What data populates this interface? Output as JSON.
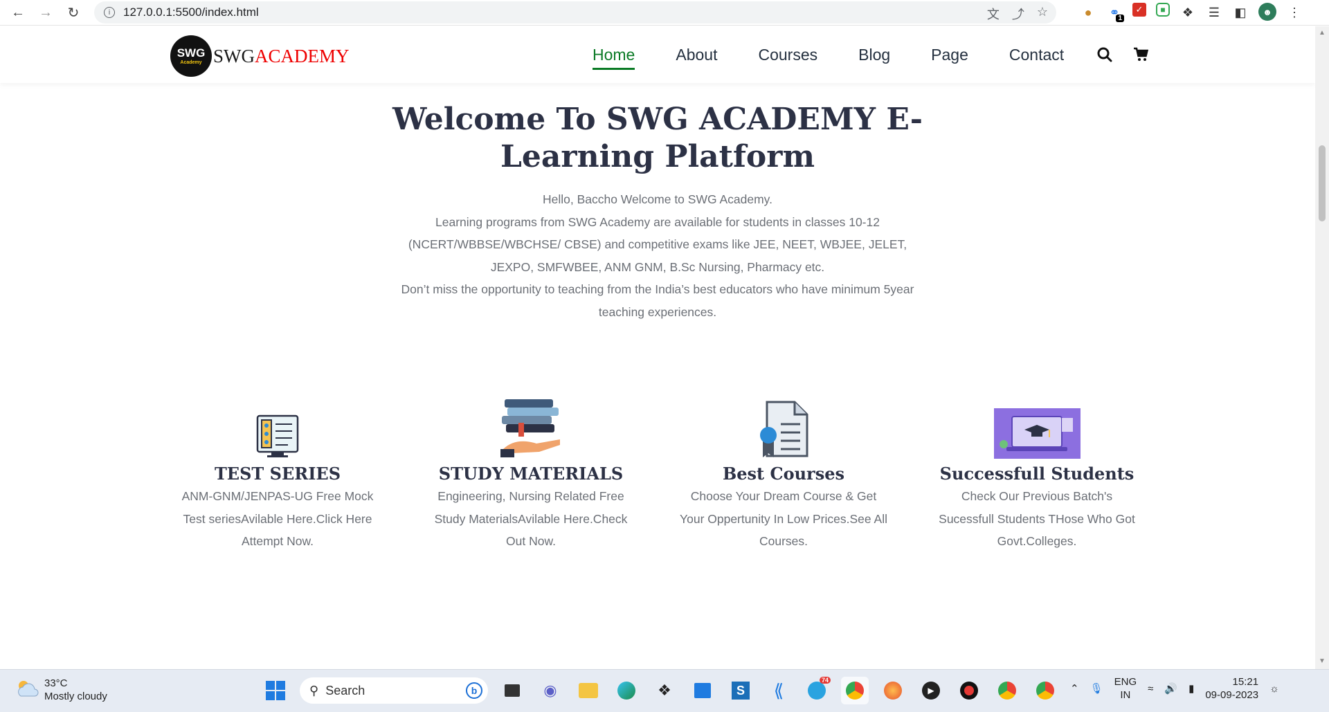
{
  "browser": {
    "url": "127.0.0.1:5500/index.html",
    "extension_badge": "1"
  },
  "site": {
    "logo_mark": "SWG",
    "logo_sub": "Academy",
    "brand_a": "SWG",
    "brand_b": "ACADEMY",
    "nav": [
      "Home",
      "About",
      "Courses",
      "Blog",
      "Page",
      "Contact"
    ],
    "active_nav": "Home"
  },
  "hero": {
    "title": "Welcome To SWG ACADEMY E-Learning Platform",
    "line1": "Hello, Baccho Welcome to SWG Academy.",
    "line2": "Learning programs from SWG Academy are available for students in classes 10-12 (NCERT/WBBSE/WBCHSE/ CBSE) and competitive exams like JEE, NEET, WBJEE, JELET, JEXPO, SMFWBEE, ANM GNM, B.Sc Nursing, Pharmacy etc.",
    "line3": "Don’t miss the opportunity to teaching from the India’s best educators who have minimum 5year teaching experiences."
  },
  "features": [
    {
      "title": "TEST SERIES",
      "text": "ANM-GNM/JENPAS-UG Free Mock Test seriesAvilable Here.Click Here Attempt Now."
    },
    {
      "title": "STUDY MATERIALS",
      "text": "Engineering, Nursing Related Free Study MaterialsAvilable Here.Check Out Now."
    },
    {
      "title": "Best Courses",
      "text": "Choose Your Dream Course & Get Your Oppertunity In Low Prices.See All Courses."
    },
    {
      "title": "Successfull Students",
      "text": "Check Our Previous Batch's Sucessfull Students THose Who Got Govt.Colleges."
    }
  ],
  "taskbar": {
    "temp": "33°C",
    "weather": "Mostly cloudy",
    "search_placeholder": "Search",
    "telegram_badge": "74",
    "lang1": "ENG",
    "lang2": "IN",
    "time": "15:21",
    "date": "09-09-2023"
  },
  "colors": {
    "accent_green": "#0a7a25",
    "brand_red": "#e00000",
    "heading": "#2c3145"
  }
}
